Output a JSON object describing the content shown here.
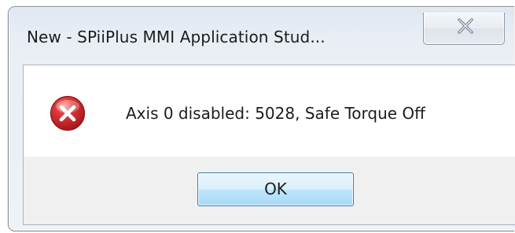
{
  "window": {
    "title": "New - SPiiPlus MMI Application Stud..."
  },
  "titlebar": {
    "close_icon": "close-icon"
  },
  "dialog": {
    "icon": "error-icon",
    "message": "Axis 0 disabled: 5028, Safe Torque Off",
    "ok_label": "OK"
  },
  "colors": {
    "error_red": "#d3272b",
    "button_border": "#3c7fb1",
    "button_fill": "#bee6fd"
  }
}
